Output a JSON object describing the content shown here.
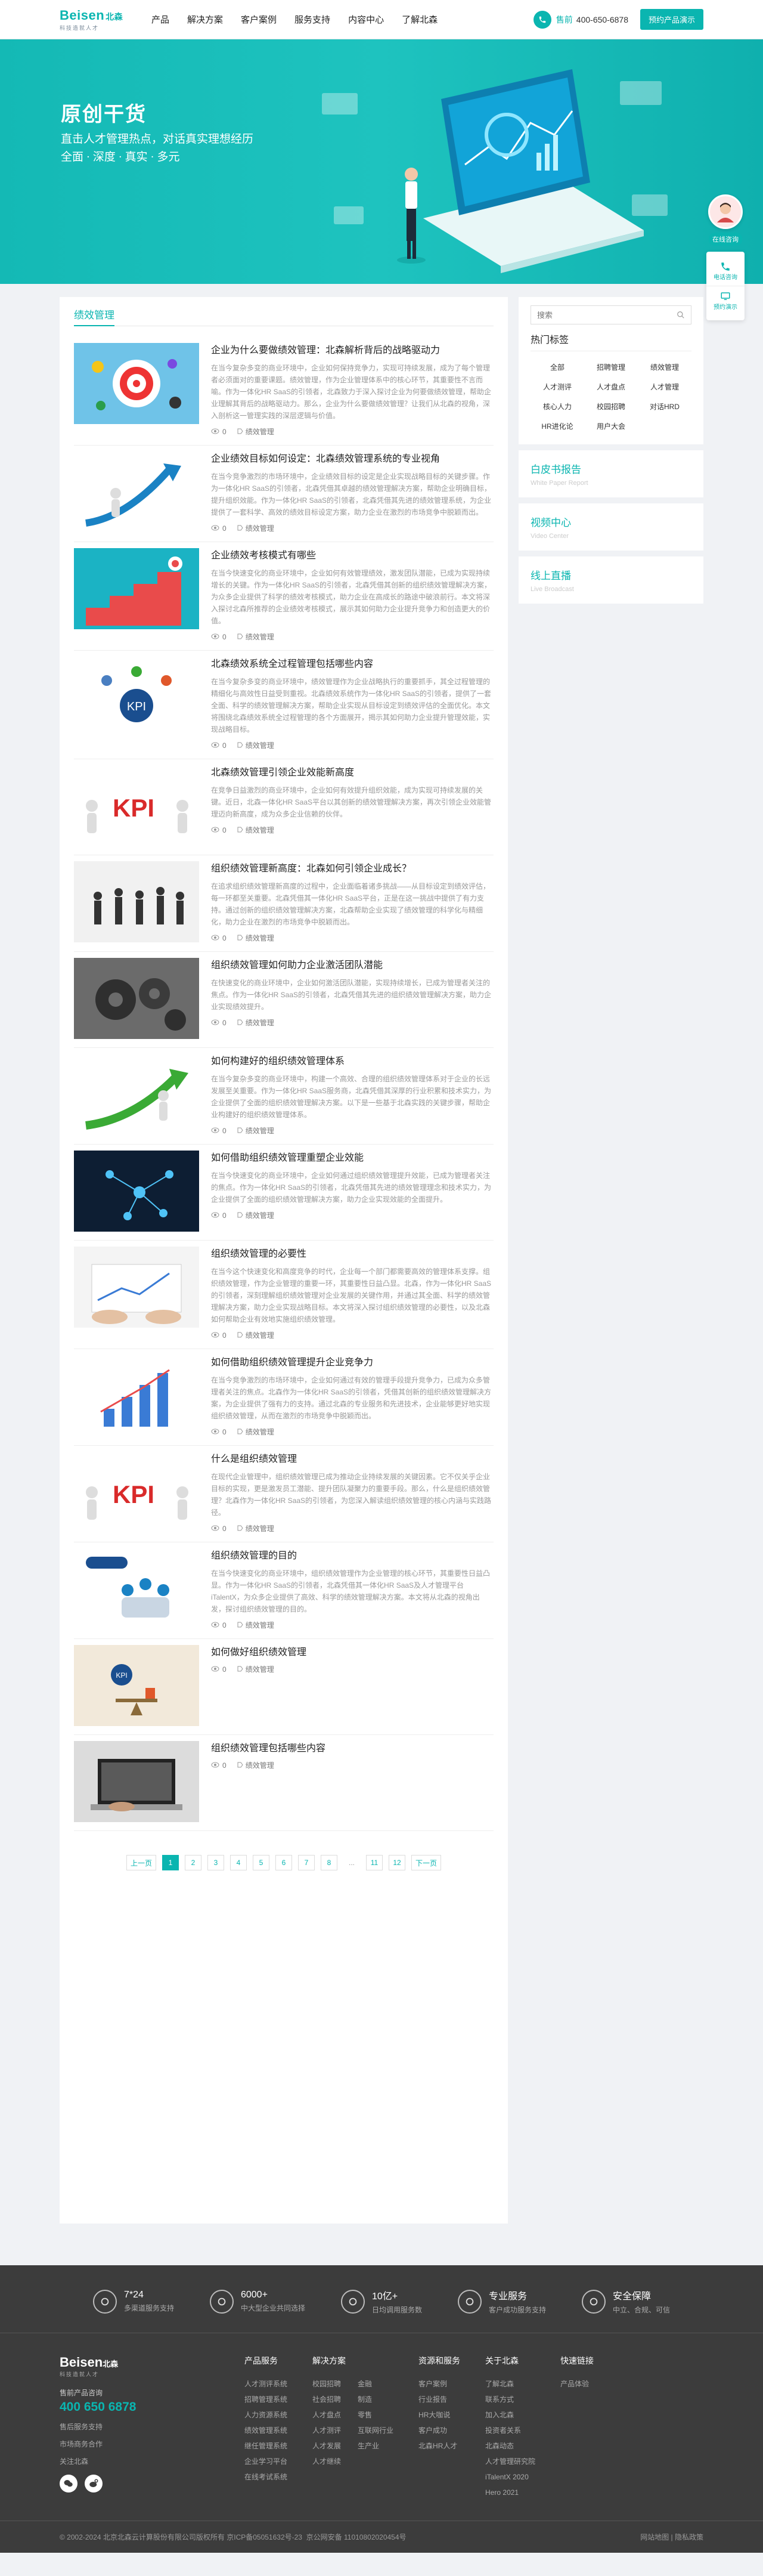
{
  "header": {
    "logo_main": "Beisen",
    "logo_cn": "北森",
    "logo_sub": "科技造就人才",
    "nav": [
      "产品",
      "解决方案",
      "客户案例",
      "服务支持",
      "内容中心",
      "了解北森"
    ],
    "phone_label": "售前",
    "phone_number": "400-650-6878",
    "demo_button": "预约产品演示"
  },
  "banner": {
    "title": "原创干货",
    "subtitle_1": "直击人才管理热点，对话真实理想经历",
    "subtitle_2": "全面 · 深度 · 真实 · 多元"
  },
  "float_side": {
    "chat": "在线咨询",
    "items": [
      "电话咨询",
      "预约演示"
    ]
  },
  "category": "绩效管理",
  "articles": [
    {
      "title": "企业为什么要做绩效管理：北森解析背后的战略驱动力",
      "desc": "在当今复杂多变的商业环境中，企业如何保持竞争力，实现可持续发展，成为了每个管理者必须面对的重要课题。绩效管理，作为企业管理体系中的核心环节，其重要性不言而喻。作为一体化HR SaaS的引领者，北森致力于深入探讨企业为何要做绩效管理，帮助企业理解其背后的战略驱动力。那么，企业为什么要做绩效管理？让我们从北森的视角，深入剖析这一管理实践的深层逻辑与价值。",
      "views": "0",
      "tag": "绩效管理",
      "img": "target"
    },
    {
      "title": "企业绩效目标如何设定：北森绩效管理系统的专业视角",
      "desc": "在当今竞争激烈的市场环境中，企业绩效目标的设定是企业实现战略目标的关键步骤。作为一体化HR SaaS的引领者，北森凭借其卓越的绩效管理解决方案，帮助企业明确目标，提升组织效能。作为一体化HR SaaS的引领者，北森凭借其先进的绩效管理系统，为企业提供了一套科学、高效的绩效目标设定方案，助力企业在激烈的市场竞争中脱颖而出。",
      "views": "0",
      "tag": "绩效管理",
      "img": "arrow"
    },
    {
      "title": "企业绩效考核模式有哪些",
      "desc": "在当今快速变化的商业环境中，企业如何有效管理绩效，激发团队潜能，已成为实现持续增长的关键。作为一体化HR SaaS的引领者，北森凭借其创新的组织绩效管理解决方案，为众多企业提供了科学的绩效考核模式，助力企业在高成长的路途中破浪前行。本文将深入探讨北森所推荐的企业绩效考核模式，展示其如何助力企业提升竞争力和创造更大的价值。",
      "views": "0",
      "tag": "绩效管理",
      "img": "stairs"
    },
    {
      "title": "北森绩效系统全过程管理包括哪些内容",
      "desc": "在当今复杂多变的商业环境中，绩效管理作为企业战略执行的重要抓手，其全过程管理的精细化与高效性日益受到重视。北森绩效系统作为一体化HR SaaS的引领者，提供了一套全面、科学的绩效管理解决方案，帮助企业实现从目标设定到绩效评估的全面优化。本文将围绕北森绩效系统全过程管理的各个方面展开，揭示其如何助力企业提升管理效能，实现战略目标。",
      "views": "0",
      "tag": "绩效管理",
      "img": "kpi-team"
    },
    {
      "title": "北森绩效管理引领企业效能新高度",
      "desc": "在竞争日益激烈的商业环境中，企业如何有效提升组织效能，成为实现可持续发展的关键。近日，北森一体化HR SaaS平台以其创新的绩效管理解决方案，再次引领企业效能管理迈向新高度，成为众多企业信赖的伙伴。",
      "views": "0",
      "tag": "绩效管理",
      "img": "kpi-red"
    },
    {
      "title": "组织绩效管理新高度：北森如何引领企业成长？",
      "desc": "在追求组织绩效管理新高度的过程中，企业面临着诸多挑战——从目标设定到绩效评估，每一环都至关重要。北森凭借其一体化HR SaaS平台，正是在这一挑战中提供了有力支持。通过创新的组织绩效管理解决方案，北森帮助企业实现了绩效管理的科学化与精细化，助力企业在激烈的市场竞争中脱颖而出。",
      "views": "0",
      "tag": "绩效管理",
      "img": "people"
    },
    {
      "title": "组织绩效管理如何助力企业激活团队潜能",
      "desc": "在快速变化的商业环境中，企业如何激活团队潜能，实现持续增长，已成为管理者关注的焦点。作为一体化HR SaaS的引领者，北森凭借其先进的组织绩效管理解决方案，助力企业实现绩效提升。",
      "views": "0",
      "tag": "绩效管理",
      "img": "gears"
    },
    {
      "title": "如何构建好的组织绩效管理体系",
      "desc": "在当今复杂多变的商业环境中，构建一个高效、合理的组织绩效管理体系对于企业的长远发展至关重要。作为一体化HR SaaS服务商，北森凭借其深厚的行业积累和技术实力，为企业提供了全面的组织绩效管理解决方案。以下是一些基于北森实践的关键步骤，帮助企业构建好的组织绩效管理体系。",
      "views": "0",
      "tag": "绩效管理",
      "img": "growth"
    },
    {
      "title": "如何借助组织绩效管理重塑企业效能",
      "desc": "在当今快速变化的商业环境中，企业如何通过组织绩效管理提升效能，已成为管理者关注的焦点。作为一体化HR SaaS的引领者，北森凭借其先进的绩效管理理念和技术实力，为企业提供了全面的组织绩效管理解决方案，助力企业实现效能的全面提升。",
      "views": "0",
      "tag": "绩效管理",
      "img": "network"
    },
    {
      "title": "组织绩效管理的必要性",
      "desc": "在当今这个快速变化和高度竞争的时代，企业每一个部门都需要高效的管理体系支撑。组织绩效管理，作为企业管理的重要一环，其重要性日益凸显。北森，作为一体化HR SaaS的引领者，深刻理解组织绩效管理对企业发展的关键作用，并通过其全面、科学的绩效管理解决方案，助力企业实现战略目标。本文将深入探讨组织绩效管理的必要性，以及北森如何帮助企业有效地实施组织绩效管理。",
      "views": "0",
      "tag": "绩效管理",
      "img": "hands"
    },
    {
      "title": "如何借助组织绩效管理提升企业竞争力",
      "desc": "在当今竞争激烈的市场环境中，企业如何通过有效的管理手段提升竞争力，已成为众多管理者关注的焦点。北森作为一体化HR SaaS的引领者，凭借其创新的组织绩效管理解决方案，为企业提供了强有力的支持。通过北森的专业服务和先进技术，企业能够更好地实现组织绩效管理，从而在激烈的市场竞争中脱颖而出。",
      "views": "0",
      "tag": "绩效管理",
      "img": "chart"
    },
    {
      "title": "什么是组织绩效管理",
      "desc": "在现代企业管理中，组织绩效管理已成为推动企业持续发展的关键因素。它不仅关乎企业目标的实现，更是激发员工潜能、提升团队凝聚力的重要手段。那么，什么是组织绩效管理？北森作为一体化HR SaaS的引领者，为您深入解读组织绩效管理的核心内涵与实践路径。",
      "views": "0",
      "tag": "绩效管理",
      "img": "kpi-red"
    },
    {
      "title": "组织绩效管理的目的",
      "desc": "在当今快速变化的商业环境中，组织绩效管理作为企业管理的核心环节，其重要性日益凸显。作为一体化HR SaaS的引领者，北森凭借其一体化HR SaaS及人才管理平台iTalentX，为众多企业提供了高效、科学的绩效管理解决方案。本文将从北森的视角出发，探讨组织绩效管理的目的。",
      "views": "0",
      "tag": "绩效管理",
      "img": "team"
    },
    {
      "title": "如何做好组织绩效管理",
      "desc": "",
      "views": "0",
      "tag": "绩效管理",
      "img": "balance"
    },
    {
      "title": "组织绩效管理包括哪些内容",
      "desc": "",
      "views": "0",
      "tag": "绩效管理",
      "img": "laptop"
    }
  ],
  "pagination": [
    "上一页",
    "1",
    "2",
    "3",
    "4",
    "5",
    "6",
    "7",
    "8",
    "...",
    "11",
    "12",
    "下一页"
  ],
  "sidebar": {
    "search_placeholder": "搜索",
    "hot_title": "热门标签",
    "tags": [
      "全部",
      "招聘管理",
      "绩效管理",
      "人才测评",
      "人才盘点",
      "人才管理",
      "核心人力",
      "校园招聘",
      "对话HRD",
      "HR进化论",
      "用户大会"
    ],
    "links": [
      {
        "title": "白皮书报告",
        "sub": "White Paper Report"
      },
      {
        "title": "视频中心",
        "sub": "Video Center"
      },
      {
        "title": "线上直播",
        "sub": "Live Broadcast"
      }
    ]
  },
  "footer": {
    "features": [
      {
        "title": "7*24",
        "sub": "多渠道服务支持"
      },
      {
        "title": "6000+",
        "sub": "中大型企业共同选择"
      },
      {
        "title": "10亿+",
        "sub": "日均调用服务数"
      },
      {
        "title": "专业服务",
        "sub": "客户成功服务支持"
      },
      {
        "title": "安全保障",
        "sub": "中立、合规、可信"
      }
    ],
    "brand": {
      "logo": "Beisen",
      "logo_cn": "北森",
      "logo_sub": "科技造就人才",
      "hotline_label": "售前产品咨询",
      "phone": "400 650 6878",
      "line1": "售后服务支持",
      "line2": "市场商务合作",
      "line3": "关注北森"
    },
    "columns": [
      {
        "title": "产品服务",
        "lists": [
          [
            "人才测评系统",
            "招聘管理系统",
            "人力资源系统",
            "绩效管理系统",
            "继任管理系统",
            "企业学习平台",
            "在线考试系统"
          ]
        ]
      },
      {
        "title": "解决方案",
        "lists": [
          [
            "校园招聘",
            "社会招聘",
            "人才盘点",
            "人才测评",
            "人才发展",
            "人才继续"
          ],
          [
            "金融",
            "制造",
            "零售",
            "互联网行业",
            "生产业"
          ]
        ]
      },
      {
        "title": "资源和服务",
        "lists": [
          [
            "客户案例",
            "行业报告",
            "HR大咖说",
            "客户成功",
            "北森HR人才"
          ]
        ]
      },
      {
        "title": "关于北森",
        "lists": [
          [
            "了解北森",
            "联系方式",
            "加入北森",
            "投资者关系",
            "北森动态",
            "人才管理研究院",
            "iTalentX 2020",
            "Hero 2021"
          ]
        ]
      },
      {
        "title": "快速链接",
        "lists": [
          [
            "产品体验"
          ]
        ]
      }
    ],
    "copyright": "© 2002-2024 北京北森云计算股份有限公司版权所有 京ICP备05051632号-23",
    "police": "京公网安备 11010802020454号",
    "right_links": "网站地图 | 隐私政策"
  },
  "colors": {
    "accent": "#0ab5b0",
    "footer_bg": "#3c3c3c"
  }
}
